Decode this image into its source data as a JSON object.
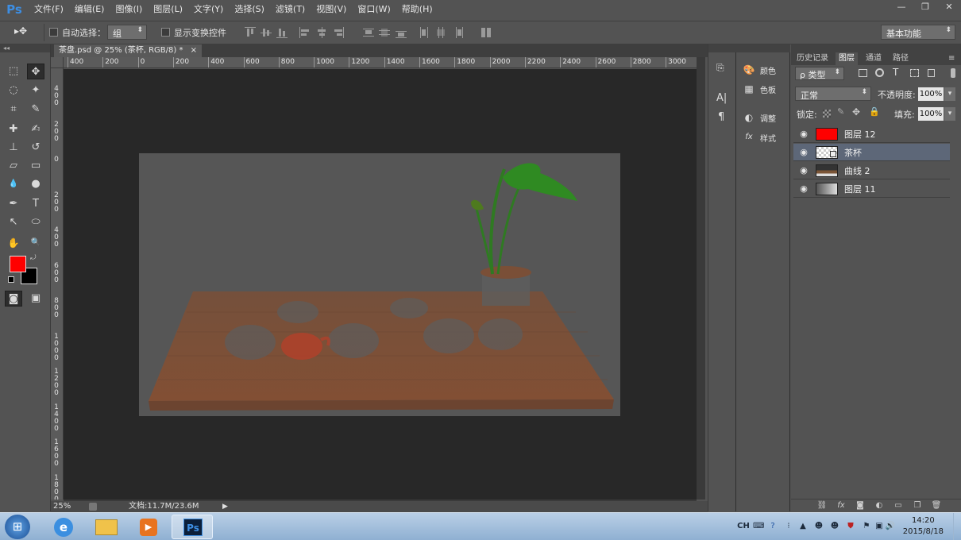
{
  "app": {
    "logo": "Ps"
  },
  "menu": [
    "文件(F)",
    "编辑(E)",
    "图像(I)",
    "图层(L)",
    "文字(Y)",
    "选择(S)",
    "滤镜(T)",
    "视图(V)",
    "窗口(W)",
    "帮助(H)"
  ],
  "window_controls": {
    "minimize": "—",
    "restore": "❐",
    "close": "✕"
  },
  "options": {
    "move_tool_glyph": "▸✥",
    "auto_select_label": "自动选择：",
    "auto_select_value": "组",
    "show_transform_label": "显示变换控件",
    "workspace": "基本功能"
  },
  "tools": {
    "marquee": "⬚",
    "move": "✥",
    "lasso": "◌",
    "magic_wand": "✦",
    "crop": "⌗",
    "eyedropper": "✎",
    "healing": "✚",
    "brush": "✍",
    "stamp": "⊥",
    "history_brush": "↺",
    "eraser": "▱",
    "gradient": "▭",
    "blur": "💧",
    "dodge": "●",
    "pen": "✒",
    "type": "T",
    "path_select": "↖",
    "shape": "⬭",
    "hand": "✋",
    "zoom": "🔍",
    "quick_mask": "◙",
    "screen_mode": "▣",
    "colors": {
      "foreground": "#ff0000",
      "background": "#000000"
    }
  },
  "document": {
    "tab_title": "茶盘.psd @ 25% (茶杯, RGB/8) *",
    "tab_close": "×",
    "ruler_h": [
      "400",
      "200",
      "0",
      "200",
      "400",
      "600",
      "800",
      "1000",
      "1200",
      "1400",
      "1600",
      "1800",
      "2000",
      "2200",
      "2400",
      "2600",
      "2800",
      "3000"
    ],
    "ruler_v": [
      "4\n0\n0",
      "2\n0\n0",
      "0",
      "2\n0\n0",
      "4\n0\n0",
      "6\n0\n0",
      "8\n0\n0",
      "1\n0\n0\n0",
      "1\n2\n0\n0",
      "1\n4\n0\n0",
      "1\n6\n0\n0",
      "1\n8\n0\n0"
    ]
  },
  "status": {
    "zoom": "25%",
    "doc_info": "文档:11.7M/23.6M",
    "arrow": "▶"
  },
  "mid_panel": [
    {
      "icon": "palette-icon",
      "glyph": "🎨",
      "label": "颜色"
    },
    {
      "icon": "swatches-icon",
      "glyph": "▦",
      "label": "色板"
    },
    {
      "icon": "adjustments-icon",
      "glyph": "◐",
      "label": "调整"
    },
    {
      "icon": "styles-icon",
      "glyph": "fx",
      "label": "样式"
    }
  ],
  "collapsed_strip": {
    "history": "⎘",
    "character": "A|",
    "paragraph": "¶"
  },
  "layers_panel": {
    "tabs": [
      "历史记录",
      "图层",
      "通道",
      "路径"
    ],
    "active_tab": "图层",
    "filter_label": "ρ 类型",
    "blend_mode": "正常",
    "opacity_label": "不透明度:",
    "opacity_value": "100%",
    "lock_label": "锁定:",
    "fill_label": "填充:",
    "fill_value": "100%",
    "layers": [
      {
        "name": "图层 12",
        "thumb": "red",
        "selected": false
      },
      {
        "name": "茶杯",
        "thumb": "smart",
        "selected": true
      },
      {
        "name": "曲线 2",
        "thumb": "curves",
        "selected": false
      },
      {
        "name": "图层 11",
        "thumb": "gradient",
        "selected": false
      }
    ],
    "bottom_icons": [
      "⛓",
      "fx",
      "◙",
      "◐",
      "▭",
      "❐",
      "🗑"
    ]
  },
  "taskbar": {
    "start": "⊞",
    "apps": [
      "ie-icon",
      "explorer-icon",
      "media-player-icon",
      "photoshop-icon"
    ],
    "ps_label": "Ps",
    "ime": "CH",
    "time": "14:20",
    "date": "2015/8/18"
  }
}
